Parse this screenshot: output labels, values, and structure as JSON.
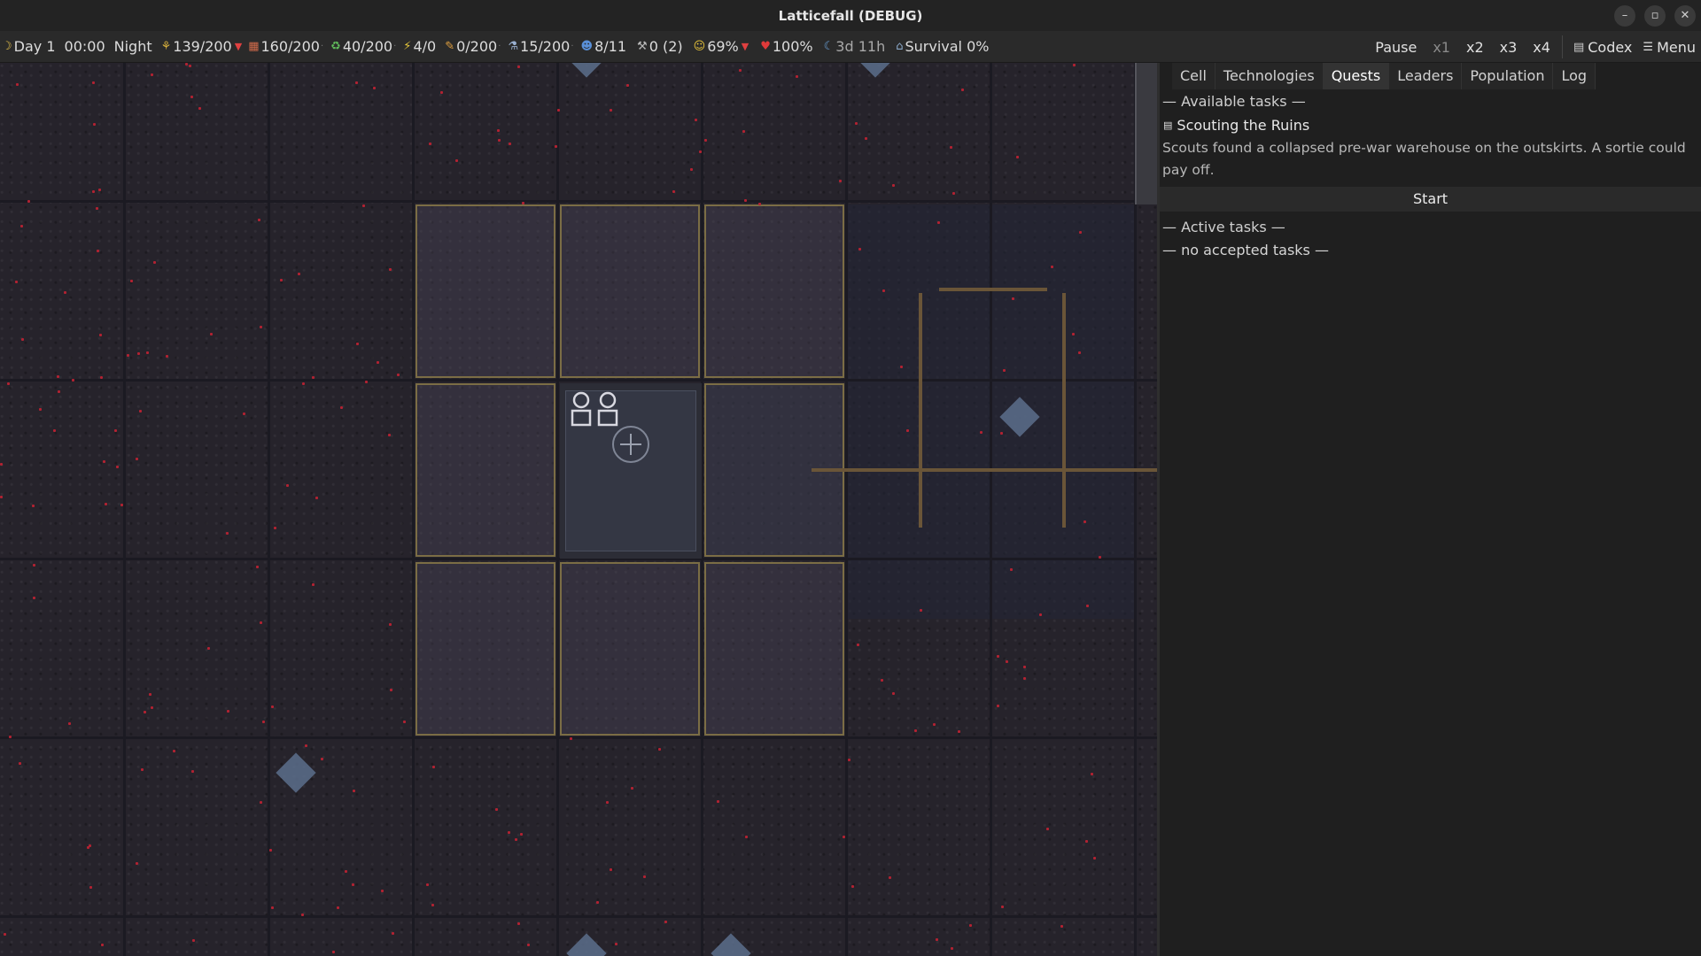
{
  "window": {
    "title": "Latticefall (DEBUG)",
    "minimize": "–",
    "maximize": "▫",
    "close": "✕"
  },
  "resources": {
    "day": "Day 1",
    "time": "00:00",
    "phase": "Night",
    "food": "139/200",
    "materials": "160/200",
    "recycle": "40/200",
    "energy": "4/0",
    "medicine": "0/200",
    "science": "15/200",
    "population": "8/11",
    "tools": "0 (2)",
    "morale": "69%",
    "health": "100%",
    "eta": "3d 11h",
    "survival": "Survival 0%"
  },
  "controls": {
    "pause": "Pause",
    "speeds": [
      "x1",
      "x2",
      "x3",
      "x4"
    ],
    "codex": "Codex",
    "menu": "Menu"
  },
  "panel": {
    "tabs": [
      "Cell",
      "Technologies",
      "Quests",
      "Leaders",
      "Population",
      "Log"
    ],
    "active_tab": "Quests",
    "available_header": "— Available tasks —",
    "quest": {
      "title": "Scouting the Ruins",
      "description": "Scouts found a collapsed pre-war warehouse on the outskirts. A sortie could pay off.",
      "start_label": "Start"
    },
    "active_header": "— Active tasks —",
    "no_tasks": "— no accepted tasks —"
  },
  "colors": {
    "accent_selected": "#7b6d45",
    "down_arrow": "#e04040",
    "resource_node": "#5c6e8c"
  }
}
